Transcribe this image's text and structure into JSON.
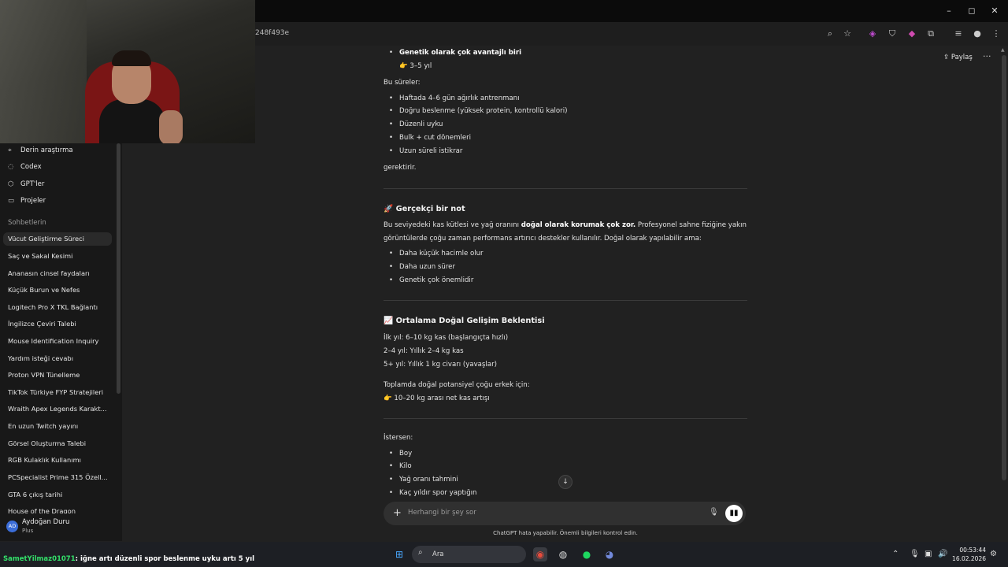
{
  "browser": {
    "url_fragment": "248f493e"
  },
  "window_controls": {
    "minimize": "–",
    "maximize": "◻",
    "close": "✕"
  },
  "sidebar": {
    "menu": [
      {
        "icon": "telescope-icon",
        "label": "Derin araştırma"
      },
      {
        "icon": "codex-icon",
        "label": "Codex"
      },
      {
        "icon": "cube-icon",
        "label": "GPT'ler"
      },
      {
        "icon": "folder-icon",
        "label": "Projeler"
      }
    ],
    "chats_heading": "Sohbetlerin",
    "chats": [
      "Vücut Geliştirme Süreci",
      "Saç ve Sakal Kesimi",
      "Ananasın cinsel faydaları",
      "Küçük Burun ve Nefes",
      "Logitech Pro X TKL Bağlantı",
      "İngilizce Çeviri Talebi",
      "Mouse Identification Inquiry",
      "Yardım isteği cevabı",
      "Proton VPN Tünelleme",
      "TikTok Türkiye FYP Stratejileri",
      "Wraith Apex Legends Karakt...",
      "En uzun Twitch yayını",
      "Görsel Oluşturma Talebi",
      "RGB Kulaklık Kullanımı",
      "PCSpecialist Prime 315 Özell...",
      "GTA 6 çıkış tarihi",
      "House of the Dragon"
    ],
    "user": {
      "initials": "AD",
      "name": "Aydoğan Duru",
      "plan": "Plus"
    }
  },
  "header": {
    "share_label": "Paylaş",
    "more_label": "···"
  },
  "content": {
    "top_bullet_bold": "Genetik olarak çok avantajlı biri",
    "top_bullet_sub": "👉 3–5 yıl",
    "bu_sureler": "Bu süreler:",
    "list1": [
      "Haftada 4–6 gün ağırlık antrenmanı",
      "Doğru beslenme (yüksek protein, kontrollü kalori)",
      "Düzenli uyku",
      "Bulk + cut dönemleri",
      "Uzun süreli istikrar"
    ],
    "gerektirir": "gerektirir.",
    "section1_title": "🚀 Gerçekçi bir not",
    "section1_p1_a": "Bu seviyedeki kas kütlesi ve yağ oranını ",
    "section1_p1_bold": "doğal olarak korumak çok zor.",
    "section1_p1_b": " Profesyonel sahne fiziğine yakın",
    "section1_p2": "görüntülerde çoğu zaman performans artırıcı destekler kullanılır. Doğal olarak yapılabilir ama:",
    "list2": [
      "Daha küçük hacimle olur",
      "Daha uzun sürer",
      "Genetik çok önemlidir"
    ],
    "section2_title": "📈 Ortalama Doğal Gelişim Beklentisi",
    "lines": [
      "İlk yıl: 6–10 kg kas (başlangıçta hızlı)",
      "2–4 yıl: Yıllık 2–4 kg kas",
      "5+ yıl: Yıllık 1 kg civarı (yavaşlar)"
    ],
    "total_label": "Toplamda doğal potansiyel çoğu erkek için:",
    "total_value": "👉 10–20 kg arası net kas artışı",
    "istersen": "İstersen:",
    "list3": [
      "Boy",
      "Kilo",
      "Yağ oranı tahmini",
      "Kaç yıldır spor yaptığın"
    ]
  },
  "composer": {
    "placeholder": "Herhangi bir şey sor",
    "disclaimer": "ChatGPT hata yapabilir. Önemli bilgileri kontrol edin."
  },
  "stream_chat": {
    "user": "SametYilmaz01071",
    "message": ": iğne artı düzenli spor beslenme uyku artı 5 yıl"
  },
  "taskbar": {
    "search_label": "Ara",
    "time": "00:53:44",
    "date": "16.02.2026"
  }
}
